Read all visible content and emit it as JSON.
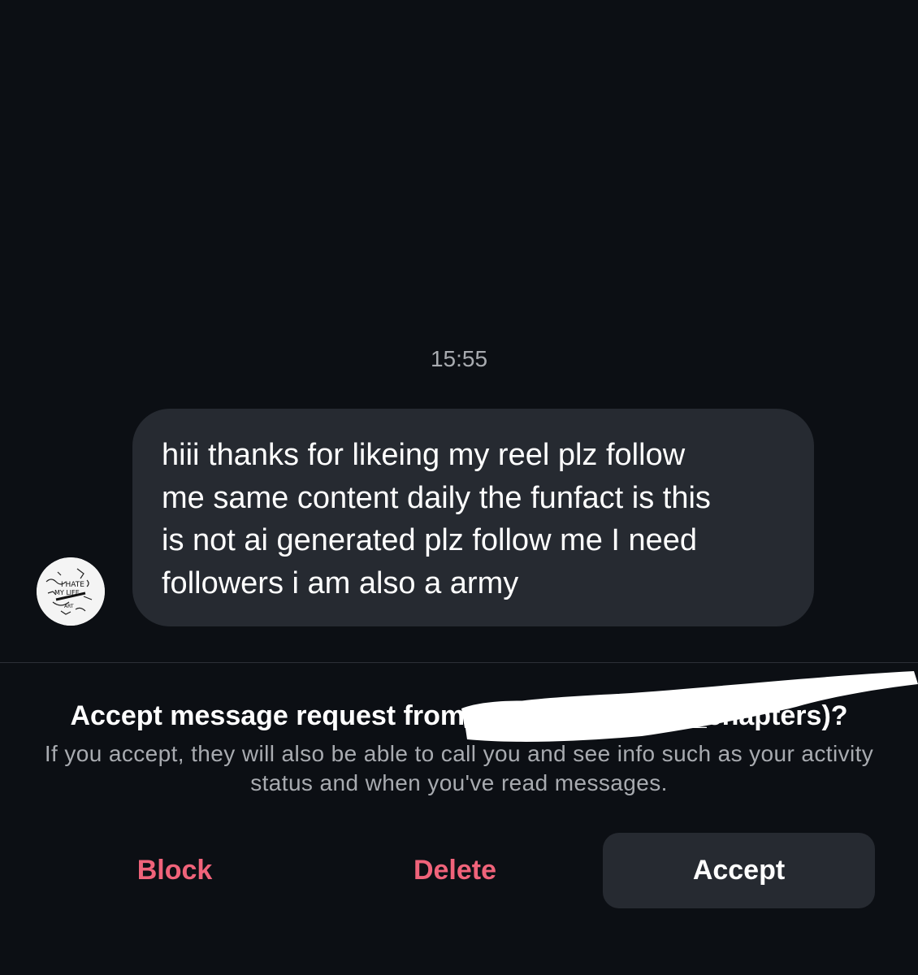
{
  "conversation": {
    "timestamp": "15:55",
    "message": {
      "lines": [
        "hiii thanks for likeing my reel plz follow",
        "me same content daily the funfact is this",
        "is not ai generated plz follow me I need",
        "followers i am also a army"
      ]
    },
    "avatar_icon": "profile-picture-icon"
  },
  "request": {
    "title": "Accept message request from",
    "title_suffix": "(...ge_and_chapters)?",
    "description": "If you accept, they will also be able to call you and see info such as your activity status and when you've read messages."
  },
  "actions": {
    "block_label": "Block",
    "delete_label": "Delete",
    "accept_label": "Accept"
  },
  "colors": {
    "background": "#0c0f14",
    "bubble": "#262a31",
    "destructive": "#f0637a",
    "secondary_text": "#a8abb0"
  }
}
